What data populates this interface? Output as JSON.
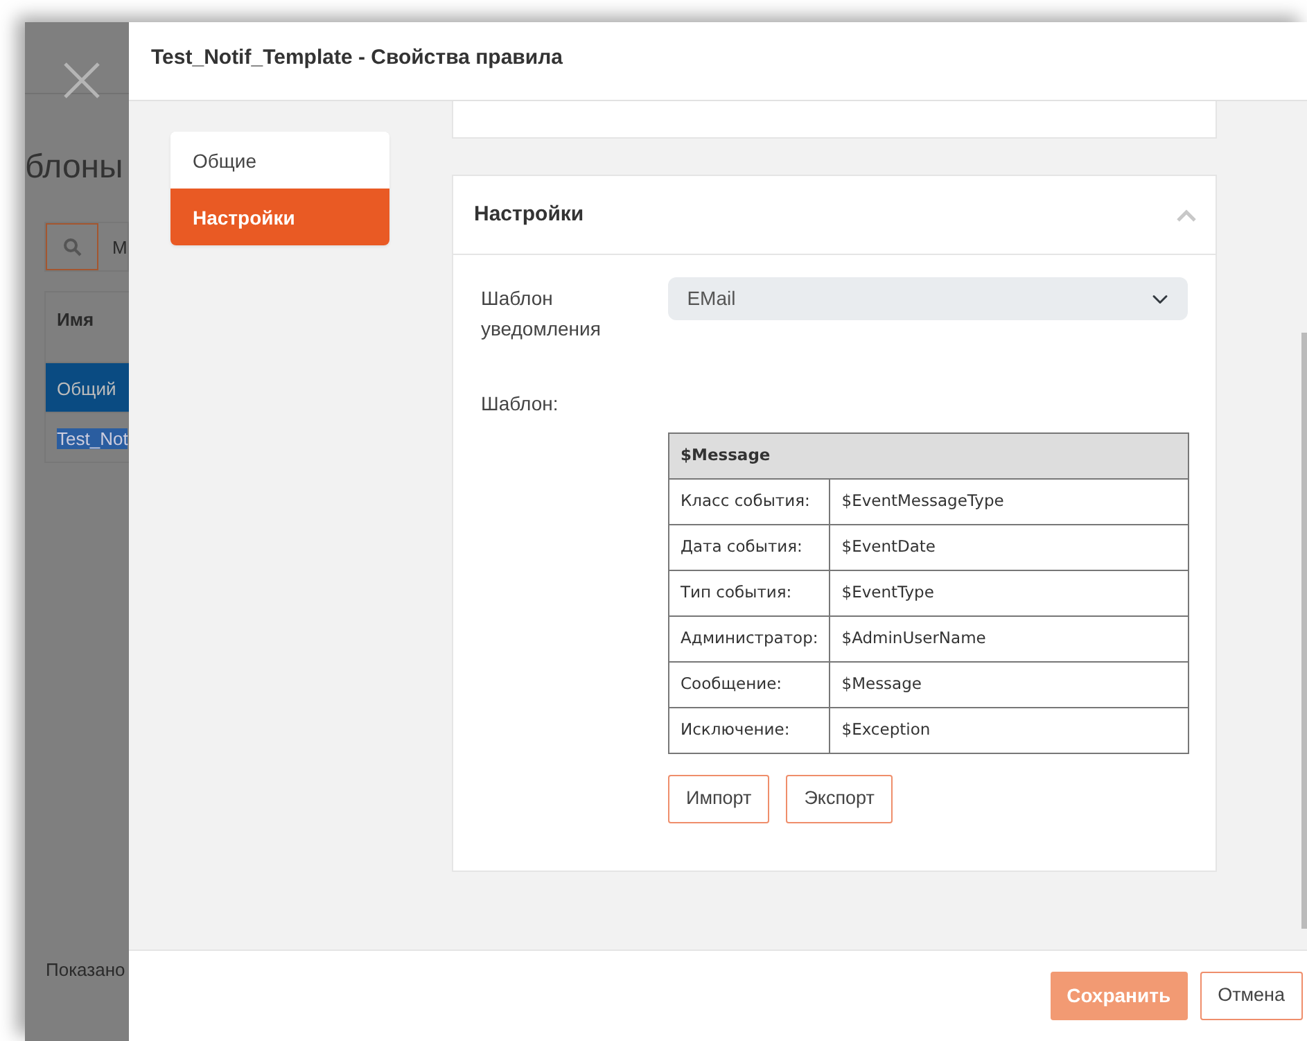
{
  "background_page": {
    "title": "блоны",
    "search": {
      "value": "М"
    },
    "table": {
      "columns": [
        "Имя"
      ],
      "rows": [
        {
          "cells": [
            "Общий"
          ],
          "selected": true,
          "highlighted": false
        },
        {
          "cells": [
            "Test_Not"
          ],
          "selected": false,
          "highlighted": true
        }
      ]
    },
    "footer": "Показано"
  },
  "dialog": {
    "title": "Test_Notif_Template - Свойства правила",
    "nav": [
      {
        "label": "Общие",
        "selected": false
      },
      {
        "label": "Настройки",
        "selected": true
      }
    ],
    "section": {
      "title": "Настройки",
      "expanded": true,
      "field": {
        "label": "Шаблон уведомления",
        "value": "EMail",
        "disabled": true
      },
      "template_label": "Шаблон:",
      "template_table": {
        "title": "$Message",
        "rows": [
          [
            "Класс события:",
            "$EventMessageType"
          ],
          [
            "Дата события:",
            "$EventDate"
          ],
          [
            "Тип события:",
            "$EventType"
          ],
          [
            "Администратор:",
            "$AdminUserName"
          ],
          [
            "Сообщение:",
            "$Message"
          ],
          [
            "Исключение:",
            "$Exception"
          ]
        ]
      },
      "buttons": [
        "Импорт",
        "Экспорт"
      ]
    },
    "footer_buttons": [
      {
        "label": "Сохранить",
        "kind": "primary",
        "disabled": true
      },
      {
        "label": "Отмена",
        "kind": "secondary",
        "disabled": false
      }
    ]
  }
}
